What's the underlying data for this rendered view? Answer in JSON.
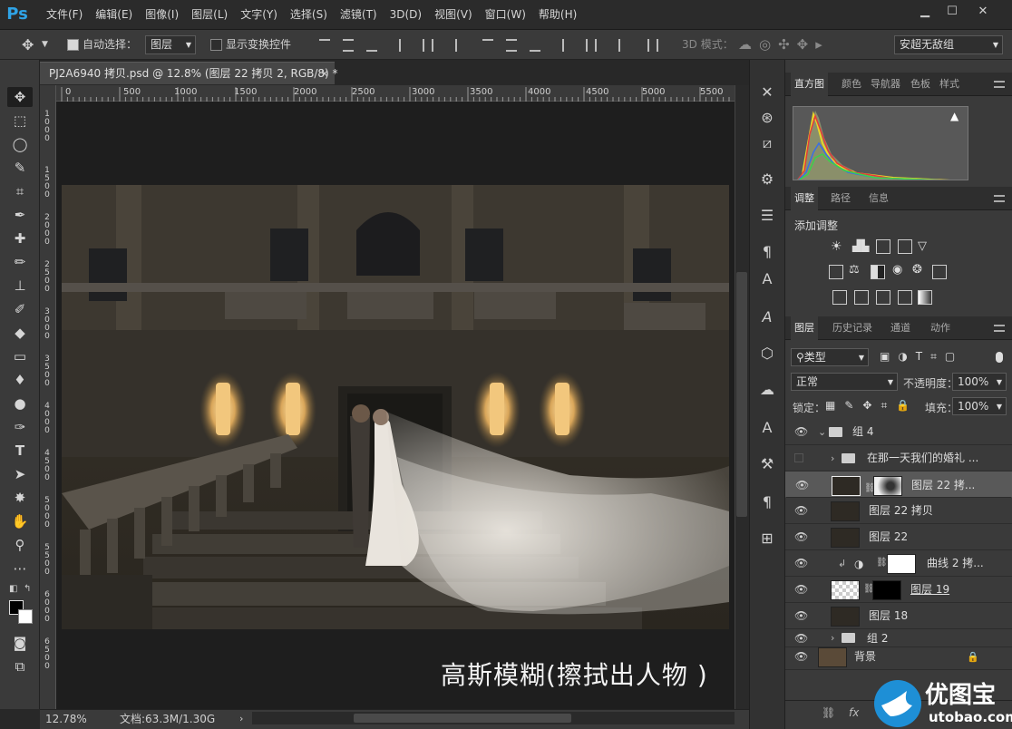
{
  "app": {
    "logo": "Ps"
  },
  "menu": [
    "文件(F)",
    "编辑(E)",
    "图像(I)",
    "图层(L)",
    "文字(Y)",
    "选择(S)",
    "滤镜(T)",
    "3D(D)",
    "视图(V)",
    "窗口(W)",
    "帮助(H)"
  ],
  "options": {
    "auto_select_label": "自动选择：",
    "auto_select_value": "图层",
    "show_transform_label": "显示变换控件",
    "mode_3d_label": "3D 模式：",
    "workspace": "安超无敌组"
  },
  "document": {
    "tab_title": "PJ2A6940 拷贝.psd @ 12.8% (图层 22 拷贝 2, RGB/8) *",
    "ruler_top": [
      "0",
      "500",
      "1000",
      "1500",
      "2000",
      "2500",
      "3000",
      "3500",
      "4000",
      "4500",
      "5000",
      "5500"
    ],
    "ruler_left": [
      "1\n0\n0\n0",
      "1\n5\n0\n0",
      "2\n0\n0\n0",
      "2\n5\n0\n0",
      "3\n0\n0\n0",
      "3\n5\n0\n0",
      "4\n0\n0\n0",
      "4\n5\n0\n0",
      "5\n0\n0\n0",
      "5\n5\n0\n0",
      "6\n0\n0\n0",
      "6\n5\n0\n0"
    ],
    "caption": "高斯模糊(擦拭出人物 )"
  },
  "status": {
    "zoom": "12.78%",
    "doc_info": "文档:63.3M/1.30G"
  },
  "panels": {
    "top_tabs": [
      "直方图",
      "颜色",
      "导航器",
      "色板",
      "样式"
    ],
    "adj_tabs": [
      "调整",
      "路径",
      "信息"
    ],
    "adj_title": "添加调整",
    "layer_tabs": [
      "图层",
      "历史记录",
      "通道",
      "动作"
    ],
    "filter_kind": "类型",
    "blend_mode": "正常",
    "opacity_label": "不透明度：",
    "opacity_value": "100%",
    "lock_label": "锁定：",
    "fill_label": "填充：",
    "fill_value": "100%"
  },
  "layers": [
    {
      "name": "组 4",
      "type": "group",
      "visible": true
    },
    {
      "name": "在那一天我们的婚礼 ...",
      "type": "group",
      "visible": false
    },
    {
      "name": "图层 22 拷...",
      "type": "masked",
      "visible": true,
      "selected": true
    },
    {
      "name": "图层 22 拷贝",
      "type": "layer",
      "visible": true
    },
    {
      "name": "图层 22",
      "type": "layer",
      "visible": true
    },
    {
      "name": "曲线 2 拷...",
      "type": "adjustment",
      "visible": true
    },
    {
      "name": "图层 19",
      "type": "masked",
      "visible": true
    },
    {
      "name": "图层 18",
      "type": "layer",
      "visible": true
    },
    {
      "name": "组 2",
      "type": "group",
      "visible": true
    },
    {
      "name": "背景",
      "type": "background",
      "visible": true
    }
  ],
  "watermark": {
    "brand": "优图宝",
    "url": "utobao.com"
  }
}
